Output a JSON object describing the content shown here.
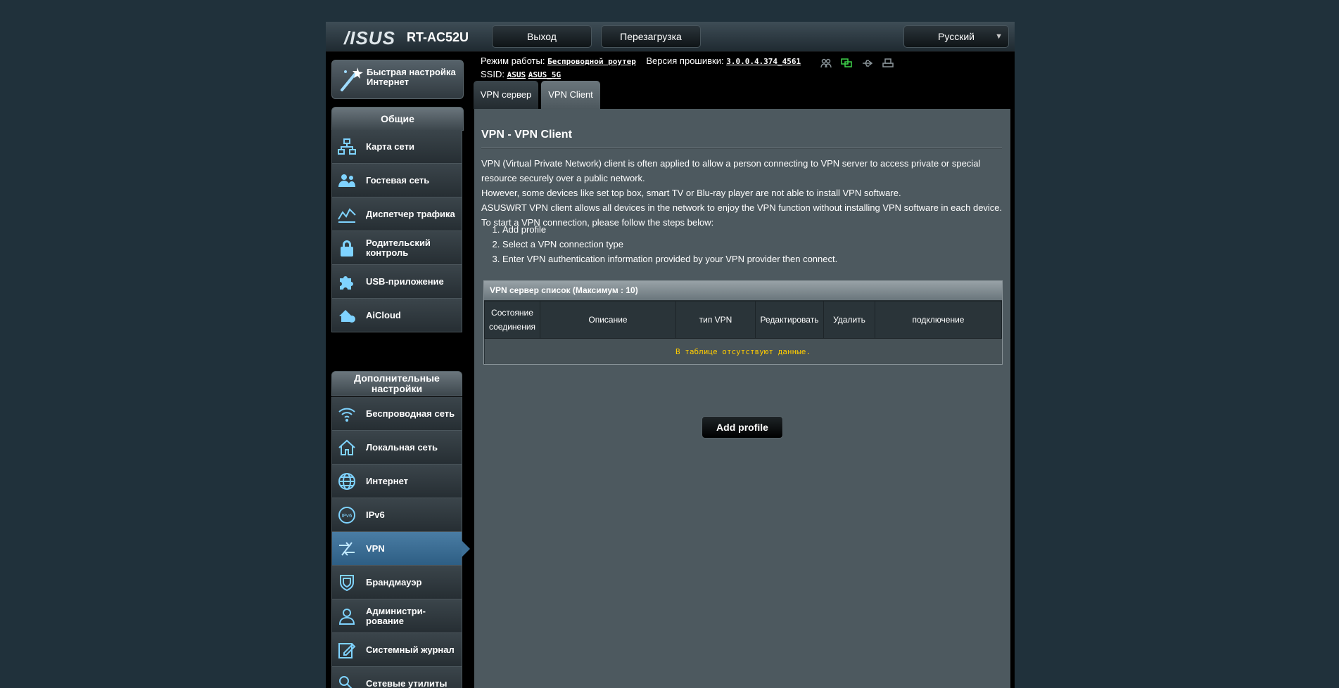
{
  "header": {
    "logo": "/ISUS",
    "model": "RT-AC52U",
    "logout_label": "Выход",
    "reboot_label": "Перезагрузка",
    "language": "Русский"
  },
  "status": {
    "mode_label": "Режим работы:",
    "mode_value": "Беспроводной роутер",
    "firmware_label": "Версия прошивки:",
    "firmware_value": "3.0.0.4.374_4561",
    "ssid_label": "SSID:",
    "ssid_1": "ASUS",
    "ssid_2": "ASUS_5G"
  },
  "sidebar": {
    "quick_setup": "Быстрая настройка Интернет",
    "general_header": "Общие",
    "general_items": [
      {
        "label": "Карта сети",
        "icon": "network-map-icon"
      },
      {
        "label": "Гостевая сеть",
        "icon": "guest-network-icon"
      },
      {
        "label": "Диспетчер трафика",
        "icon": "traffic-manager-icon"
      },
      {
        "label": "Родительский контроль",
        "icon": "parental-control-icon"
      },
      {
        "label": "USB-приложение",
        "icon": "usb-app-icon"
      },
      {
        "label": "AiCloud",
        "icon": "aicloud-icon"
      }
    ],
    "advanced_header": "Дополнительные настройки",
    "advanced_items": [
      {
        "label": "Беспроводная сеть",
        "icon": "wireless-icon"
      },
      {
        "label": "Локальная сеть",
        "icon": "lan-icon"
      },
      {
        "label": "Интернет",
        "icon": "wan-icon"
      },
      {
        "label": "IPv6",
        "icon": "ipv6-icon"
      },
      {
        "label": "VPN",
        "icon": "vpn-icon"
      },
      {
        "label": "Брандмауэр",
        "icon": "firewall-icon"
      },
      {
        "label": "Администри-рование",
        "icon": "admin-icon"
      },
      {
        "label": "Системный журнал",
        "icon": "syslog-icon"
      },
      {
        "label": "Сетевые утилиты",
        "icon": "network-tools-icon"
      }
    ]
  },
  "tabs": [
    {
      "label": "VPN сервер"
    },
    {
      "label": "VPN Client"
    }
  ],
  "main": {
    "title": "VPN - VPN Client",
    "desc_1": "VPN (Virtual Private Network) client is often applied to allow a person connecting to VPN server to access private or special resource securely over a public network.",
    "desc_2": "However, some devices like set top box, smart TV or Blu-ray player are not able to install VPN software.",
    "desc_3": "ASUSWRT VPN client allows all devices in the network to enjoy the VPN function without installing VPN software in each device.",
    "desc_4": "To start a VPN connection, please follow the steps below:",
    "steps": [
      "Add profile",
      "Select a VPN connection type",
      "Enter VPN authentication information provided by your VPN provider then connect."
    ],
    "table_caption": "VPN сервер список (Максимум : 10)",
    "columns": [
      "Состояние соединения",
      "Описание",
      "тип VPN",
      "Редактировать",
      "Удалить",
      "подключение"
    ],
    "empty_text": "В таблице отсутствуют данные.",
    "add_profile_label": "Add profile"
  }
}
